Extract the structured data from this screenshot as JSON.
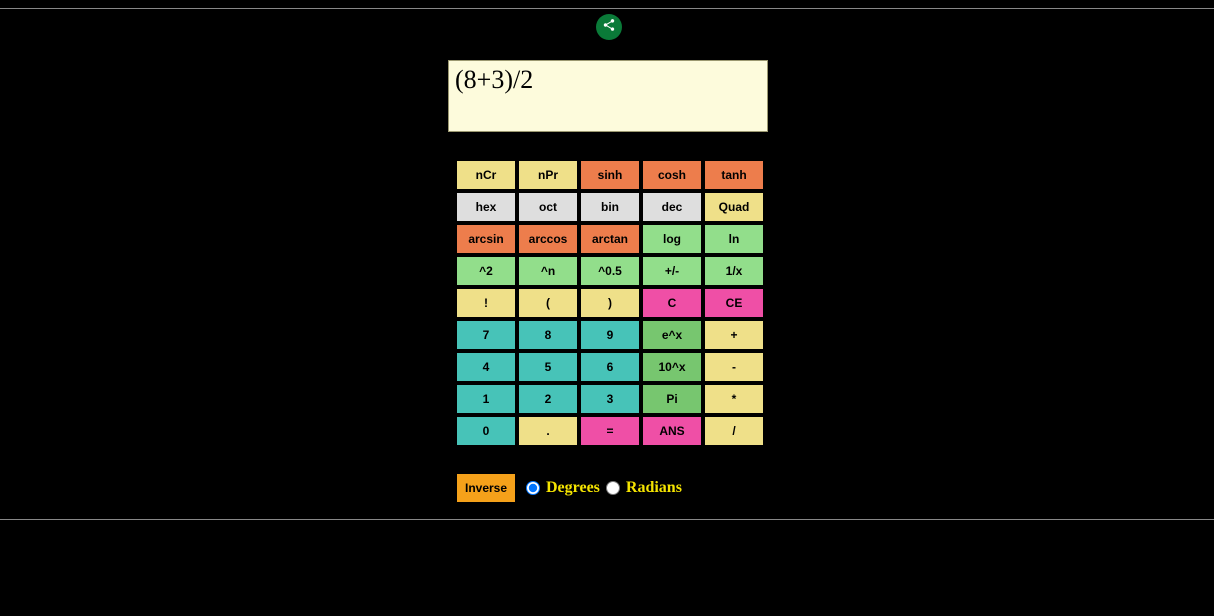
{
  "display": "(8+3)/2",
  "buttons": {
    "r0": [
      "nCr",
      "nPr",
      "sinh",
      "cosh",
      "tanh"
    ],
    "r1": [
      "hex",
      "oct",
      "bin",
      "dec",
      "Quad"
    ],
    "r2": [
      "arcsin",
      "arccos",
      "arctan",
      "log",
      "ln"
    ],
    "r3": [
      "^2",
      "^n",
      "^0.5",
      "+/-",
      "1/x"
    ],
    "r4": [
      "!",
      "(",
      ")",
      "C",
      "CE"
    ],
    "r5": [
      "7",
      "8",
      "9",
      "e^x",
      "+"
    ],
    "r6": [
      "4",
      "5",
      "6",
      "10^x",
      "-"
    ],
    "r7": [
      "1",
      "2",
      "3",
      "Pi",
      "*"
    ],
    "r8": [
      "0",
      ".",
      "=",
      "ANS",
      "/"
    ]
  },
  "footer": {
    "inverse": "Inverse",
    "degrees": "Degrees",
    "radians": "Radians"
  }
}
